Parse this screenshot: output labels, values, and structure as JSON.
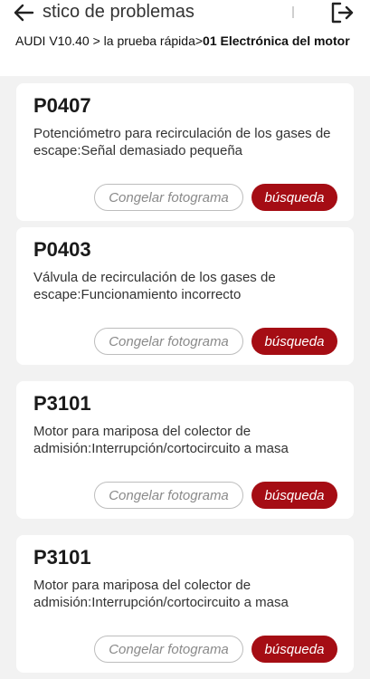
{
  "header": {
    "title": "stico de problemas",
    "back_icon": "arrow-left-icon",
    "exit_icon": "logout-icon"
  },
  "breadcrumb": {
    "path": "AUDI V10.40 > la prueba rápida>",
    "current": "01 Electrónica del motor"
  },
  "colors": {
    "accent": "#a50d14",
    "background": "#f2f2f2"
  },
  "dtc_list": [
    {
      "code": "P0407",
      "description": "Potenciómetro para recirculación de los gases de escape:Señal demasiado pequeña",
      "freeze_label": "Congelar fotograma",
      "search_label": "búsqueda"
    },
    {
      "code": "P0403",
      "description": "Válvula de recirculación de los gases de escape:Funcionamiento incorrecto",
      "freeze_label": "Congelar fotograma",
      "search_label": "búsqueda"
    },
    {
      "code": "P3101",
      "description": "Motor para mariposa del colector de admisión:Interrupción/cortocircuito a masa",
      "freeze_label": "Congelar fotograma",
      "search_label": "búsqueda"
    },
    {
      "code": "P3101",
      "description": "Motor para mariposa del colector de admisión:Interrupción/cortocircuito a masa",
      "freeze_label": "Congelar fotograma",
      "search_label": "búsqueda"
    }
  ]
}
